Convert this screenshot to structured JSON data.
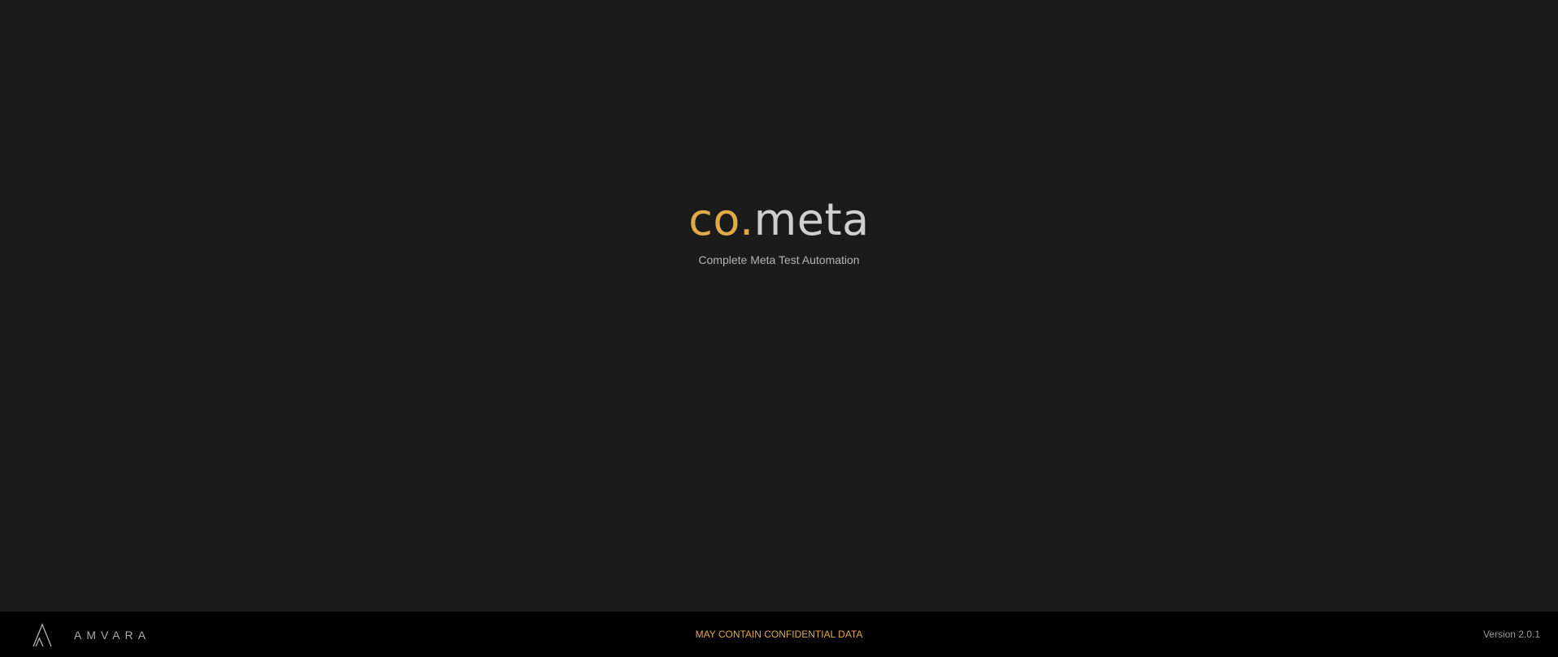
{
  "app": {
    "logo_prefix": "co.",
    "logo_suffix": "meta",
    "tagline": "Complete Meta Test Automation"
  },
  "footer": {
    "brand_icon": "amvara-logo-icon",
    "brand_name": "AMVARA",
    "notice": "MAY CONTAIN CONFIDENTIAL DATA",
    "version": "Version 2.0.1"
  },
  "colors": {
    "background": "#1b1b1b",
    "footer_background": "#000000",
    "accent": "#e0a94a",
    "logo_text": "#cfcfcf"
  }
}
